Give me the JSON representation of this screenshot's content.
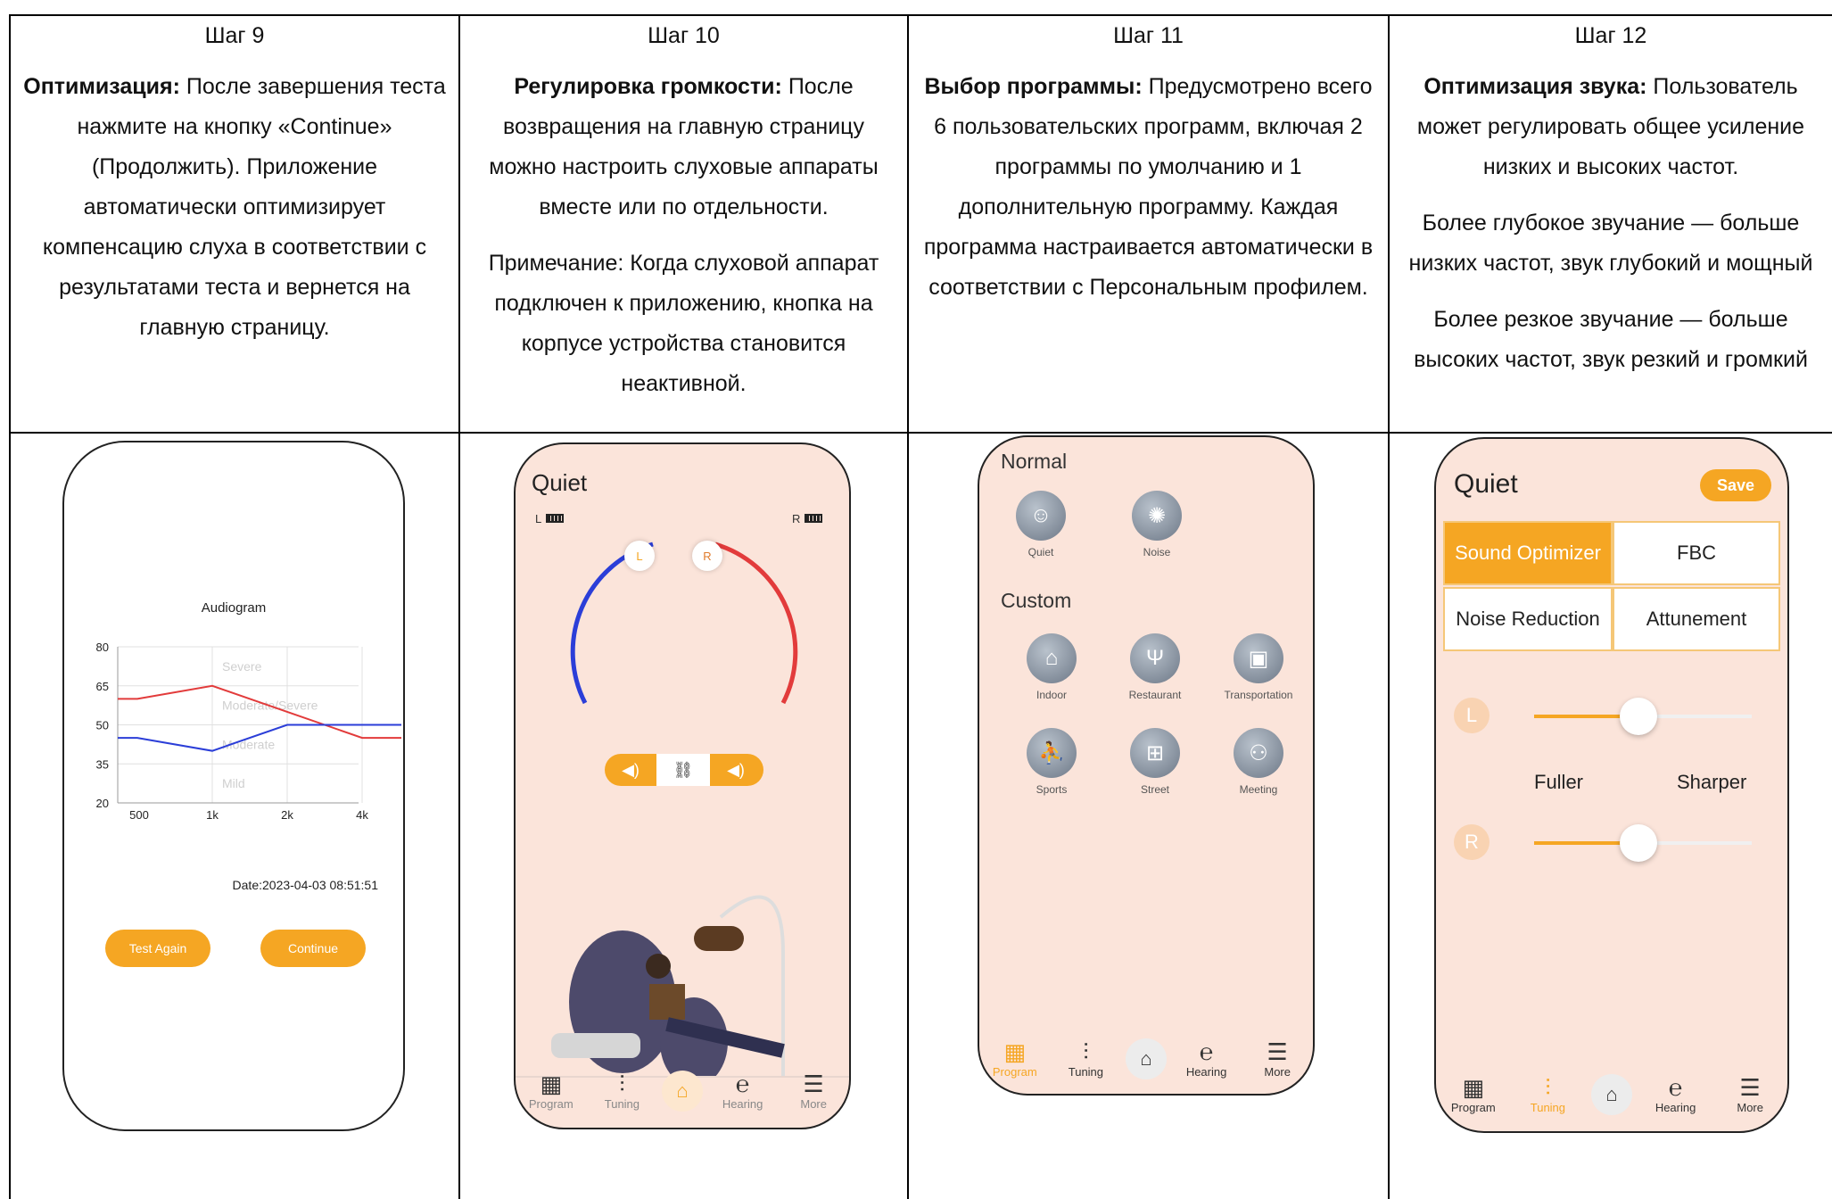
{
  "steps": [
    {
      "title": "Шаг 9",
      "bold": "Оптимизация:",
      "text": " После завершения теста нажмите на кнопку «Continue» (Продолжить). Приложение автоматически оптимизирует компенсацию слуха в соответствии с результатами теста и вернется на главную страницу."
    },
    {
      "title": "Шаг 10",
      "bold": "Регулировка громкости:",
      "text": " После возвращения на главную страницу можно настроить слуховые аппараты вместе или по отдельности.",
      "note": "Примечание: Когда слуховой аппарат подключен к приложению, кнопка на корпусе устройства становится неактивной."
    },
    {
      "title": "Шаг 11",
      "bold": "Выбор программы:",
      "text": " Предусмотрено всего 6 пользовательских программ, включая 2 программы по умолчанию и 1 дополнительную программу. Каждая программа настраивается автоматически в соответствии с Персональным профилем."
    },
    {
      "title": "Шаг 12",
      "bold": "Оптимизация звука:",
      "text": " Пользователь может регулировать общее усиление низких и высоких частот.",
      "note1": "Более глубокое звучание — больше низких частот, звук глубокий и мощный",
      "note2": "Более резкое звучание — больше высоких частот, звук резкий и громкий"
    }
  ],
  "phone1": {
    "title": "Audiogram",
    "zones": [
      "Severe",
      "Moderate/Severe",
      "Moderate",
      "Mild"
    ],
    "date": "Date:2023-04-03 08:51:51",
    "buttons": {
      "test_again": "Test Again",
      "continue": "Continue"
    }
  },
  "chart_data": {
    "type": "line",
    "title": "Audiogram",
    "x": [
      "500",
      "1k",
      "2k",
      "4k"
    ],
    "y_ticks": [
      80,
      65,
      50,
      35,
      20
    ],
    "ylim": [
      20,
      80
    ],
    "grid": true,
    "series": [
      {
        "color": "#e23b3b",
        "values": [
          60,
          65,
          55,
          45
        ]
      },
      {
        "color": "#2b3ed8",
        "values": [
          45,
          40,
          50,
          50
        ]
      }
    ]
  },
  "phone2": {
    "title": "Quiet",
    "left": "L",
    "right": "R",
    "knob_left": "L",
    "knob_right": "R",
    "arc_left_color": "#2b3ed8",
    "arc_right_color": "#e23b3b"
  },
  "phone3": {
    "normal_title": "Normal",
    "custom_title": "Custom",
    "normal_programs": [
      {
        "label": "Quiet",
        "icon": "person-icon"
      },
      {
        "label": "Noise",
        "icon": "noise-icon"
      }
    ],
    "custom_programs": [
      {
        "label": "Indoor",
        "icon": "indoor-icon"
      },
      {
        "label": "Restaurant",
        "icon": "fork-knife-icon"
      },
      {
        "label": "Transportation",
        "icon": "bus-icon"
      },
      {
        "label": "Sports",
        "icon": "runner-icon"
      },
      {
        "label": "Street",
        "icon": "map-icon"
      },
      {
        "label": "Meeting",
        "icon": "group-icon"
      }
    ]
  },
  "phone4": {
    "title": "Quiet",
    "save": "Save",
    "segments": [
      "Sound Optimizer",
      "FBC",
      "Noise Reduction",
      "Attunement"
    ],
    "ear_left": "L",
    "ear_right": "R",
    "fuller": "Fuller",
    "sharper": "Sharper",
    "slider_left_level": 0.48,
    "slider_right_level": 0.48
  },
  "tabs_p2": [
    "Program",
    "Tuning",
    "Hearing",
    "More"
  ],
  "tabs_p3": [
    "Program",
    "Tuning",
    "Hearing",
    "More"
  ],
  "tabs_p4": [
    "Program",
    "Tuning",
    "Hearing",
    "More"
  ],
  "accent": "#f5a623"
}
